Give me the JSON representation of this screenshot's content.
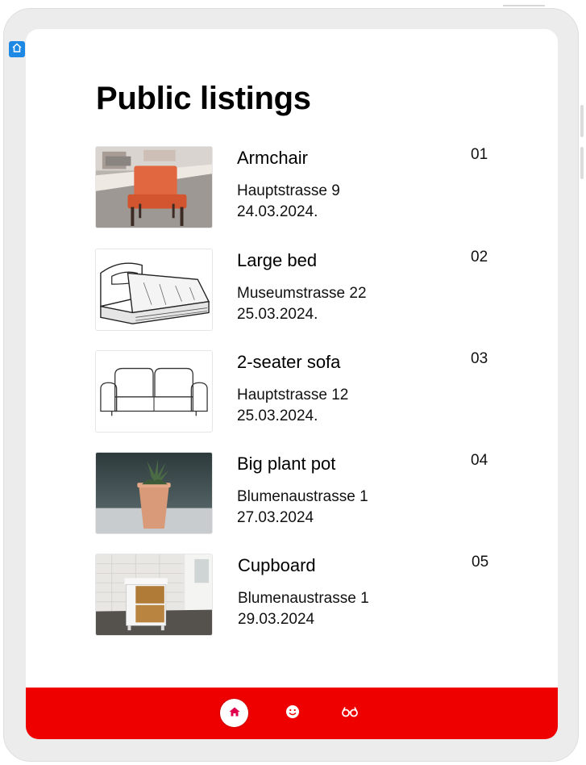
{
  "page": {
    "title": "Public listings"
  },
  "listings": [
    {
      "name": "Armchair",
      "address": "Hauptstrasse 9",
      "date": "24.03.2024.",
      "number": "01",
      "image": "armchair-photo"
    },
    {
      "name": "Large bed",
      "address": "Museumstrasse 22",
      "date": "25.03.2024.",
      "number": "02",
      "image": "bed-sketch"
    },
    {
      "name": "2-seater sofa",
      "address": "Hauptstrasse 12",
      "date": "25.03.2024.",
      "number": "03",
      "image": "sofa-line-drawing"
    },
    {
      "name": "Big plant pot",
      "address": "Blumenaustrasse 1",
      "date": "27.03.2024",
      "number": "04",
      "image": "plant-pot-photo"
    },
    {
      "name": "Cupboard",
      "address": "Blumenaustrasse 1",
      "date": "29.03.2024",
      "number": "05",
      "image": "cupboard-photo"
    }
  ],
  "navbar": {
    "items": [
      "home-icon",
      "smiley-icon",
      "glasses-icon"
    ],
    "colors": {
      "background": "#ee0000",
      "active_icon": "#e0004d"
    }
  },
  "badge": {
    "icon": "home-icon",
    "color": "#1e88e5"
  }
}
